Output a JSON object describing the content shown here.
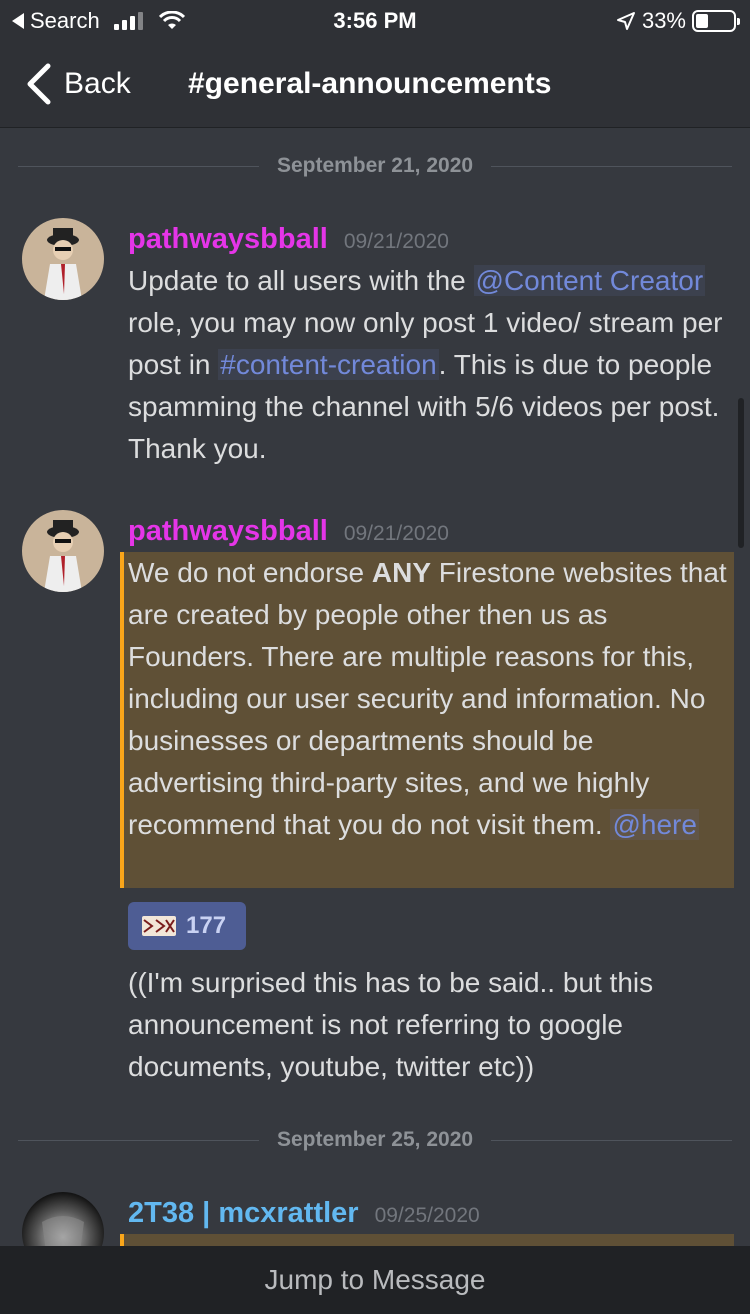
{
  "status_bar": {
    "back_app": "Search",
    "time": "3:56 PM",
    "battery": "33%",
    "battery_level": 0.33
  },
  "header": {
    "back_label": "Back",
    "channel": "#general-announcements"
  },
  "dividers": [
    "September 21, 2020",
    "September 25, 2020"
  ],
  "messages": [
    {
      "username": "pathwaysbball",
      "username_color": "#e535e8",
      "timestamp": "09/21/2020",
      "text_1": "Update to all users with the ",
      "mention_1": "@Content Creator",
      "text_2": " role, you may now only post 1 video/ stream per post in ",
      "channel_mention": "#content-creation",
      "text_3": ". This is due to people spamming the channel with 5/6 videos per post. Thank you."
    },
    {
      "username": "pathwaysbball",
      "username_color": "#e535e8",
      "timestamp": "09/21/2020",
      "text_1": "We do not endorse ",
      "bold": "ANY",
      "text_2": " Firestone websites that are created by people other then us as Founders. There are multiple reasons for this, including our user security and information. No businesses or departments should be advertising third-party sites, and we highly recommend that you do not visit them. ",
      "mention": "@here",
      "reaction_count": "177",
      "follow_up": "((I'm surprised this has to be said.. but this announcement is not referring to google documents, youtube, twitter etc))"
    },
    {
      "username": "2T38 | mcxrattler",
      "username_color": "#62b8f0",
      "timestamp": "09/25/2020"
    }
  ],
  "footer": {
    "jump_label": "Jump to Message"
  },
  "icons": [
    "back-chevron-icon",
    "signal-icon",
    "wifi-icon",
    "location-arrow-icon",
    "battery-icon",
    "emoji-reaction-icon"
  ]
}
